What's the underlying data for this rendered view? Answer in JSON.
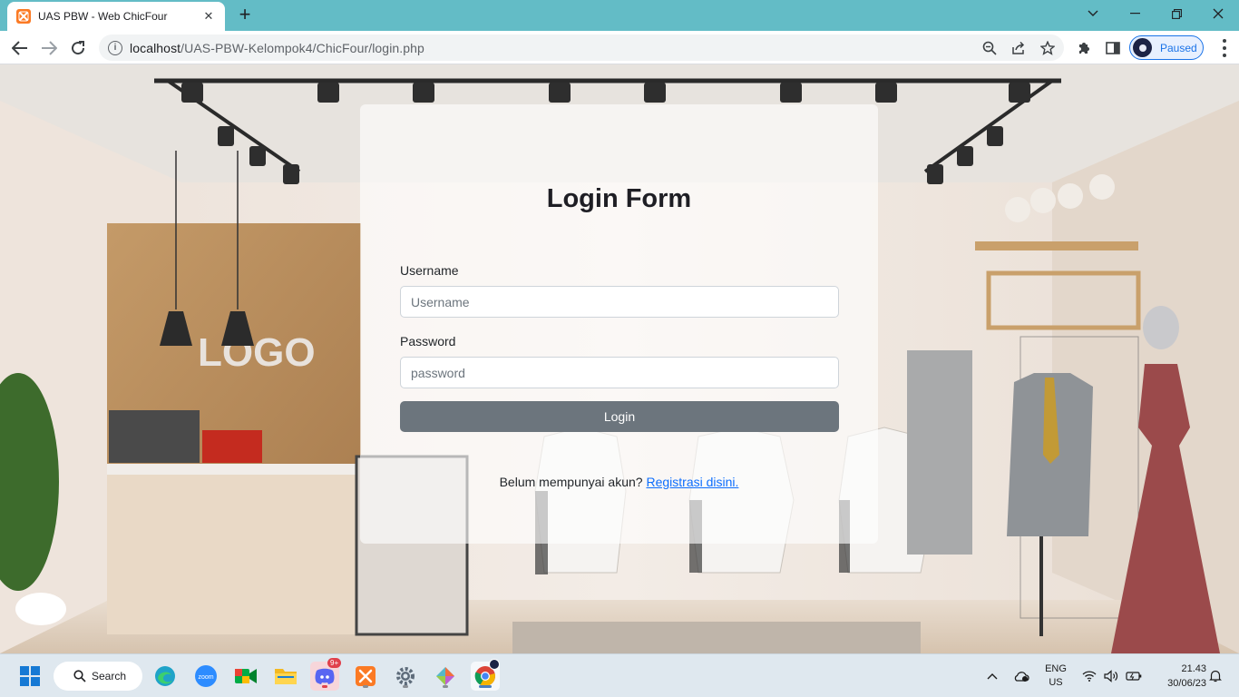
{
  "browser": {
    "tab_title": "UAS PBW - Web ChicFour",
    "url_host": "localhost",
    "url_path": "/UAS-PBW-Kelompok4/ChicFour/login.php",
    "profile_status": "Paused",
    "accent_color": "#63bcc6"
  },
  "page": {
    "background_logo": "LOGO",
    "form": {
      "title": "Login Form",
      "username_label": "Username",
      "username_placeholder": "Username",
      "password_label": "Password",
      "password_placeholder": "password",
      "login_button": "Login",
      "register_prompt": "Belum mempunyai akun?",
      "register_link": "Registrasi disini."
    }
  },
  "taskbar": {
    "search_label": "Search",
    "zoom_label": "zoom",
    "discord_badge": "9+",
    "language_line1": "ENG",
    "language_line2": "US",
    "time": "21.43",
    "date": "30/06/23"
  }
}
